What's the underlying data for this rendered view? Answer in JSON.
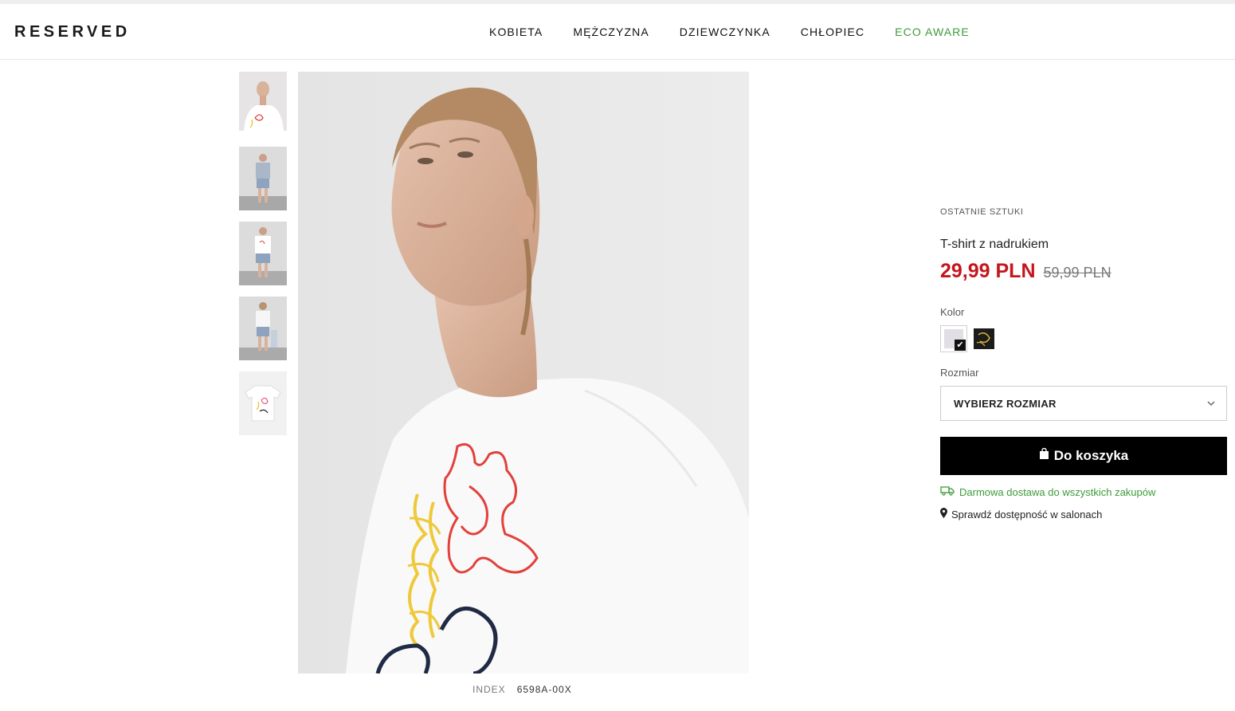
{
  "header": {
    "logo": "RESERVED",
    "nav": [
      {
        "label": "KOBIETA"
      },
      {
        "label": "MĘŻCZYZNA"
      },
      {
        "label": "DZIEWCZYNKA"
      },
      {
        "label": "CHŁOPIEC"
      },
      {
        "label": "ECO AWARE"
      }
    ]
  },
  "gallery": {
    "thumbnail_count": 5,
    "active_thumbnail": 1,
    "index_label": "INDEX",
    "index_value": "6598A-00X"
  },
  "product": {
    "badge": "OSTATNIE SZTUKI",
    "name": "T-shirt z nadrukiem",
    "price_now": "29,99 PLN",
    "price_old": "59,99 PLN",
    "color_label": "Kolor",
    "size_label": "Rozmiar",
    "size_placeholder": "WYBIERZ ROZMIAR",
    "cart_button": "Do koszyka",
    "delivery_text": "Darmowa dostawa do wszystkich zakupów",
    "store_text": "Sprawdź dostępność w salonach"
  },
  "colors": {
    "accent_price": "#c4161c",
    "eco_green": "#3e9a39",
    "button_black": "#000000"
  }
}
